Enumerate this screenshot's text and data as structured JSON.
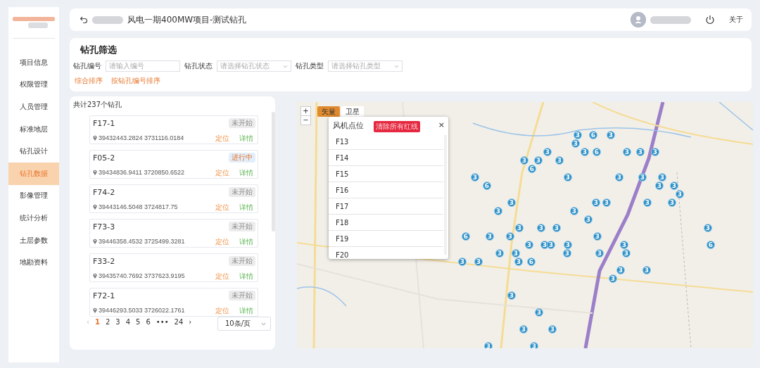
{
  "sidebar": {
    "items": [
      {
        "label": "项目信息",
        "selected": false
      },
      {
        "label": "权限管理",
        "selected": false
      },
      {
        "label": "人员管理",
        "selected": false
      },
      {
        "label": "标准地层",
        "selected": false
      },
      {
        "label": "钻孔设计",
        "selected": false
      },
      {
        "label": "钻孔数据",
        "selected": true
      },
      {
        "label": "影像管理",
        "selected": false
      },
      {
        "label": "统计分析",
        "selected": false
      },
      {
        "label": "土层参数",
        "selected": false
      },
      {
        "label": "地勘资料",
        "selected": false
      }
    ]
  },
  "header": {
    "title": "风电一期400MW项目-测试钻孔",
    "about": "关于"
  },
  "filter": {
    "title": "钻孔筛选",
    "fields": [
      {
        "label": "钻孔编号",
        "placeholder": "请输入编号",
        "kind": "input"
      },
      {
        "label": "钻孔状态",
        "placeholder": "请选择钻孔状态",
        "kind": "select"
      },
      {
        "label": "钻孔类型",
        "placeholder": "请选择钻孔类型",
        "kind": "select"
      }
    ],
    "sorts": [
      "综合排序",
      "按钻孔编号排序"
    ]
  },
  "list": {
    "total": "共计237个钻孔",
    "items": [
      {
        "name": "F17-1",
        "status": "未开始",
        "kind": "pending",
        "coords": "39432443.2824 3731116.0184",
        "locate": "定位",
        "detail": "详情"
      },
      {
        "name": "F05-2",
        "status": "进行中",
        "kind": "active",
        "coords": "39434836.9411 3720850.6522",
        "locate": "定位",
        "detail": "详情"
      },
      {
        "name": "F74-2",
        "status": "未开始",
        "kind": "pending",
        "coords": "39443146.5048 3724817.75",
        "locate": "定位",
        "detail": "详情"
      },
      {
        "name": "F73-3",
        "status": "未开始",
        "kind": "pending",
        "coords": "39446358.4532 3725499.3281",
        "locate": "定位",
        "detail": "详情"
      },
      {
        "name": "F33-2",
        "status": "未开始",
        "kind": "pending",
        "coords": "39435740.7692 3737623.9195",
        "locate": "定位",
        "detail": "详情"
      },
      {
        "name": "F72-1",
        "status": "未开始",
        "kind": "pending",
        "coords": "39446293.5033 3726022.1761",
        "locate": "定位",
        "detail": "详情"
      }
    ],
    "pagination": {
      "prev": "‹",
      "next": "›",
      "ellipsis": "•••",
      "page_size": "10条/页",
      "pages": [
        {
          "label": "1",
          "selected": true
        },
        {
          "label": "2",
          "selected": false
        },
        {
          "label": "3",
          "selected": false
        },
        {
          "label": "4",
          "selected": false
        },
        {
          "label": "5",
          "selected": false
        },
        {
          "label": "6",
          "selected": false
        },
        {
          "label": "24",
          "selected": false
        }
      ]
    }
  },
  "map": {
    "zoom_in": "+",
    "zoom_out": "−",
    "layers": [
      {
        "label": "矢量",
        "selected": true
      },
      {
        "label": "卫星",
        "selected": false
      }
    ],
    "popup": {
      "title": "风机点位",
      "action": "清除所有红线",
      "close": "×",
      "items": [
        "F13",
        "F14",
        "F15",
        "F16",
        "F17",
        "F18",
        "F19",
        "F20"
      ]
    },
    "markers": [
      "3",
      "6",
      "3",
      "3",
      "3",
      "3",
      "6",
      "3",
      "3",
      "3",
      "3",
      "3",
      "3",
      "6",
      "3",
      "3",
      "3",
      "3",
      "3",
      "6",
      "3",
      "3",
      "3",
      "3",
      "3",
      "3",
      "3",
      "3",
      "3",
      "3",
      "3",
      "3",
      "3",
      "3",
      "3",
      "6",
      "3",
      "3",
      "3",
      "3",
      "3",
      "3",
      "3",
      "3",
      "6",
      "3",
      "3",
      "3",
      "3",
      "3",
      "3",
      "3",
      "3",
      "6",
      "3",
      "3",
      "3",
      "3",
      "3",
      "3",
      "3",
      "3",
      "3"
    ]
  }
}
